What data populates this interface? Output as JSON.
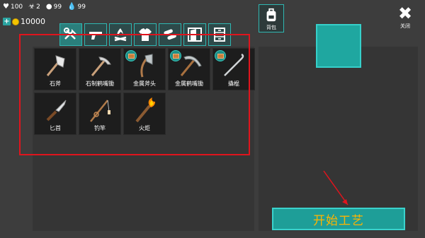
{
  "stats": {
    "health": "100",
    "radiation": "2",
    "food": "99",
    "water": "99"
  },
  "currency": {
    "coins": "10000"
  },
  "categories": [
    "tools",
    "weapons",
    "fire",
    "clothing",
    "materials",
    "building",
    "storage"
  ],
  "backpack_label": "背包",
  "close_label": "关闭",
  "items": [
    {
      "name": "石斧",
      "locked": false
    },
    {
      "name": "石制鹤嘴锄",
      "locked": false
    },
    {
      "name": "金属斧头",
      "locked": true
    },
    {
      "name": "金属鹤嘴锄",
      "locked": true
    },
    {
      "name": "撬棍",
      "locked": true
    },
    {
      "name": "匕首",
      "locked": false
    },
    {
      "name": "钓竿",
      "locked": false
    },
    {
      "name": "火炬",
      "locked": false
    }
  ],
  "start_button": "开始工艺",
  "colors": {
    "accent": "#1e9e98",
    "highlight_box": "#e0141d",
    "button_text": "#ffb400"
  }
}
